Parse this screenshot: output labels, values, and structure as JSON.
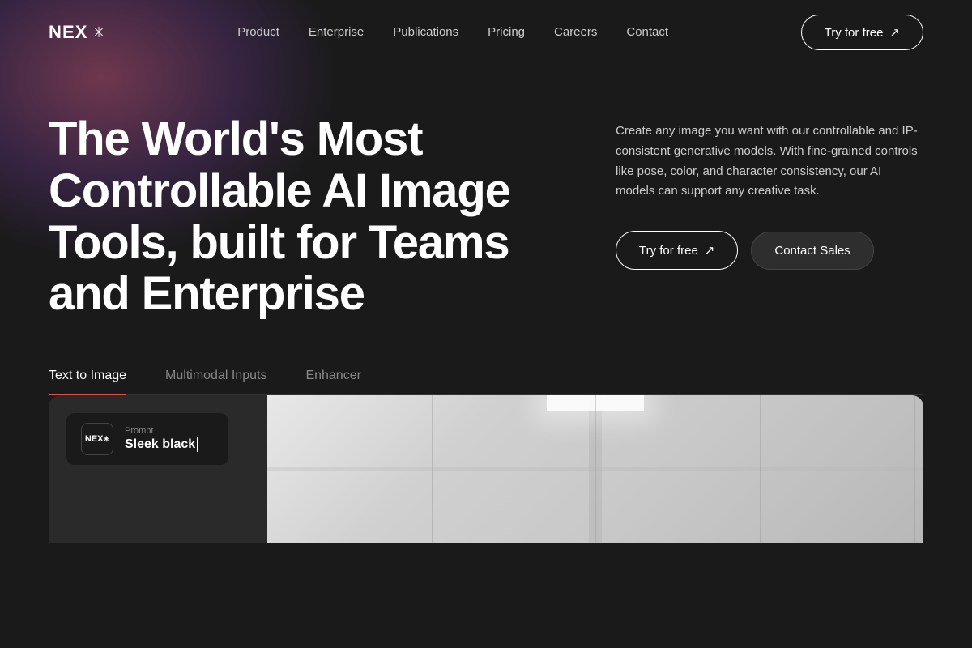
{
  "brand": {
    "name": "NEX",
    "snowflake": "✳",
    "logo_label": "NEX logo"
  },
  "nav": {
    "links": [
      {
        "label": "Product",
        "id": "product"
      },
      {
        "label": "Enterprise",
        "id": "enterprise"
      },
      {
        "label": "Publications",
        "id": "publications"
      },
      {
        "label": "Pricing",
        "id": "pricing"
      },
      {
        "label": "Careers",
        "id": "careers"
      },
      {
        "label": "Contact",
        "id": "contact"
      }
    ],
    "cta_label": "Try for free",
    "cta_arrow": "↗"
  },
  "hero": {
    "title": "The World's Most Controllable AI Image Tools, built for Teams and Enterprise",
    "description": "Create any image you want with our controllable and IP-consistent generative models. With fine-grained controls like pose, color, and character consistency, our AI models can support any creative task.",
    "cta_primary_label": "Try for free",
    "cta_primary_arrow": "↗",
    "cta_secondary_label": "Contact Sales"
  },
  "tabs": [
    {
      "label": "Text to Image",
      "id": "text-to-image",
      "active": true
    },
    {
      "label": "Multimodal Inputs",
      "id": "multimodal",
      "active": false
    },
    {
      "label": "Enhancer",
      "id": "enhancer",
      "active": false
    }
  ],
  "demo": {
    "logo_text": "NEX",
    "logo_snowflake": "✳",
    "prompt_label": "Prompt",
    "prompt_text": "Sleek black",
    "cursor": "|"
  }
}
